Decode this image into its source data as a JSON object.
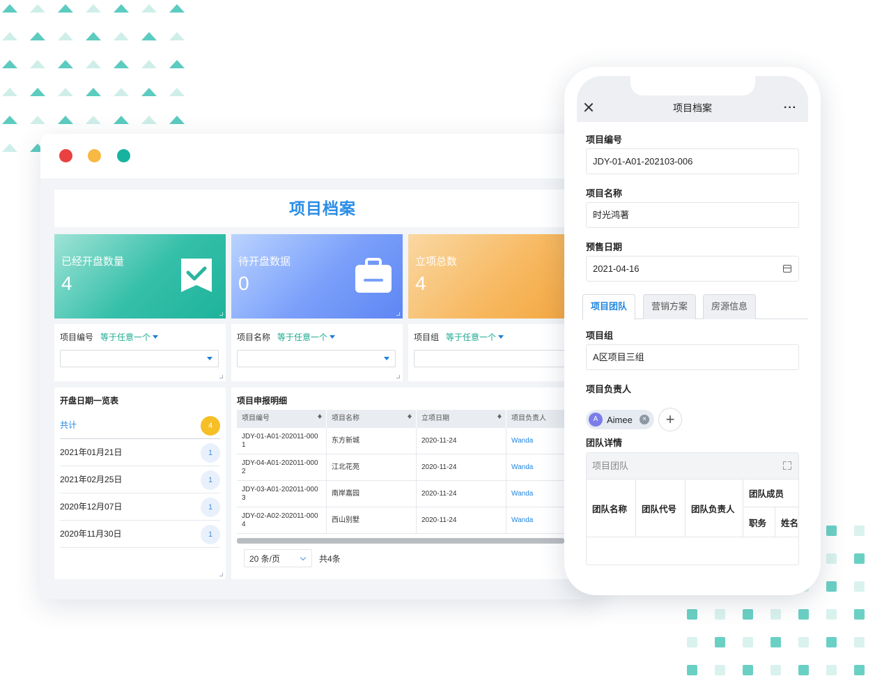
{
  "desktop": {
    "title": "项目档案",
    "stats": [
      {
        "label": "已经开盘数量",
        "value": "4"
      },
      {
        "label": "待开盘数据",
        "value": "0"
      },
      {
        "label": "立项总数",
        "value": "4"
      }
    ],
    "filters": [
      {
        "field": "项目编号",
        "op": "等于任意一个"
      },
      {
        "field": "项目名称",
        "op": "等于任意一个"
      },
      {
        "field": "项目组",
        "op": "等于任意一个"
      }
    ],
    "date_list": {
      "title": "开盘日期一览表",
      "total_label": "共计",
      "total_count": "4",
      "items": [
        {
          "date": "2021年01月21日",
          "count": "1"
        },
        {
          "date": "2021年02月25日",
          "count": "1"
        },
        {
          "date": "2020年12月07日",
          "count": "1"
        },
        {
          "date": "2020年11月30日",
          "count": "1"
        }
      ]
    },
    "detail_table": {
      "title": "项目申报明细",
      "columns": [
        "项目编号",
        "项目名称",
        "立项日期",
        "项目负责人"
      ],
      "rows": [
        [
          "JDY-01-A01-202011-0001",
          "东方新城",
          "2020-11-24",
          "Wanda"
        ],
        [
          "JDY-04-A01-202011-0002",
          "江北花苑",
          "2020-11-24",
          "Wanda"
        ],
        [
          "JDY-03-A01-202011-0003",
          "南岸嘉园",
          "2020-11-24",
          "Wanda"
        ],
        [
          "JDY-02-A02-202011-0004",
          "西山别墅",
          "2020-11-24",
          "Wanda"
        ]
      ],
      "page_size": "20 条/页",
      "total": "共4条"
    }
  },
  "mobile": {
    "title": "项目档案",
    "project_no_label": "项目编号",
    "project_no": "JDY-01-A01-202103-006",
    "project_name_label": "项目名称",
    "project_name": "时光鸿著",
    "presale_date_label": "预售日期",
    "presale_date": "2021-04-16",
    "tabs": [
      "项目团队",
      "营销方案",
      "房源信息"
    ],
    "group_label": "项目组",
    "group": "A区项目三组",
    "owner_label": "项目负责人",
    "owner_initial": "A",
    "owner_name": "Aimee",
    "team_detail_label": "团队详情",
    "team_sub_label": "项目团队",
    "team_columns": {
      "name": "团队名称",
      "code": "团队代号",
      "lead": "团队负责人",
      "members": "团队成员",
      "position": "职务",
      "member_name": "姓名"
    }
  },
  "colors": {
    "accent": "#1f86e0",
    "teal": "#1fb39b",
    "blue": "#5e86f3",
    "orange": "#f3a33a"
  }
}
